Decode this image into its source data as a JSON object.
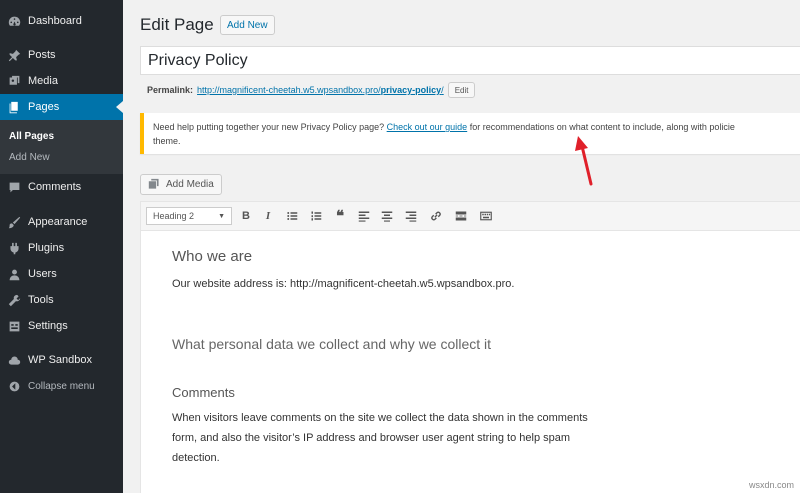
{
  "sidebar": {
    "items": [
      {
        "label": "Dashboard",
        "icon": "dashboard-icon"
      },
      {
        "label": "Posts",
        "icon": "pushpin-icon"
      },
      {
        "label": "Media",
        "icon": "media-icon"
      },
      {
        "label": "Pages",
        "icon": "pages-icon"
      },
      {
        "label": "Comments",
        "icon": "comments-icon"
      },
      {
        "label": "Appearance",
        "icon": "brush-icon"
      },
      {
        "label": "Plugins",
        "icon": "plugin-icon"
      },
      {
        "label": "Users",
        "icon": "users-icon"
      },
      {
        "label": "Tools",
        "icon": "wrench-icon"
      },
      {
        "label": "Settings",
        "icon": "settings-icon"
      },
      {
        "label": "WP Sandbox",
        "icon": "cloud-icon"
      },
      {
        "label": "Collapse menu",
        "icon": "collapse-icon"
      }
    ],
    "submenu": [
      "All Pages",
      "Add New"
    ]
  },
  "header": {
    "title": "Edit Page",
    "add_new": "Add New"
  },
  "post_title": "Privacy Policy",
  "permalink": {
    "label": "Permalink:",
    "base": "http://magnificent-cheetah.w5.wpsandbox.pro/",
    "slug": "privacy-policy",
    "trailing": "/",
    "edit": "Edit"
  },
  "notice": {
    "before": "Need help putting together your new Privacy Policy page? ",
    "link": "Check out our guide",
    "after": " for recommendations on what content to include, along with policie",
    "line2": "theme."
  },
  "add_media": "Add Media",
  "toolbar": {
    "format": "Heading 2"
  },
  "content": {
    "h1": "Who we are",
    "p1": "Our website address is: http://magnificent-cheetah.w5.wpsandbox.pro.",
    "h2": "What personal data we collect and why we collect it",
    "h3": "Comments",
    "p2": "When visitors leave comments on the site we collect the data shown in the comments form, and also the visitor’s IP address and browser user agent string to help spam detection."
  },
  "watermark": "wsxdn.com",
  "colors": {
    "sidebar_bg": "#23282d",
    "active_bg": "#0073aa",
    "notice_border": "#ffb900",
    "arrow": "#e0202a"
  }
}
